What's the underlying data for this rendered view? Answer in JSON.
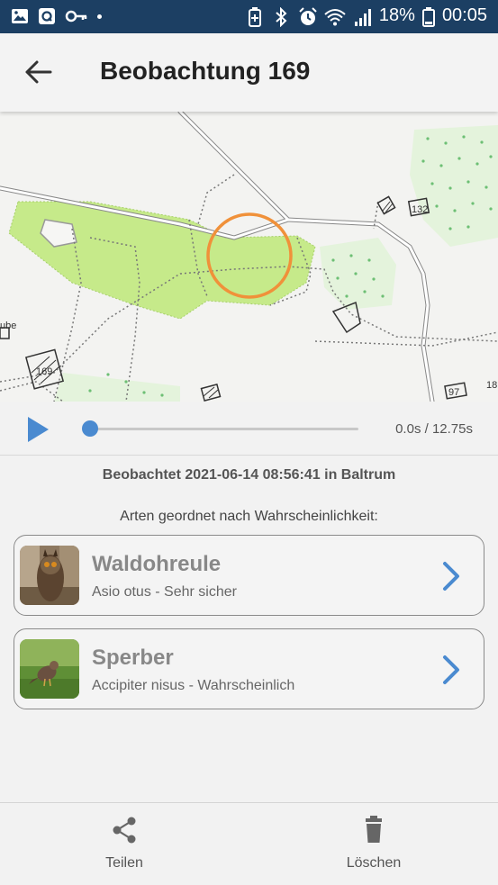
{
  "status_bar": {
    "battery": "18%",
    "time": "00:05"
  },
  "header": {
    "title": "Beobachtung 169"
  },
  "map": {
    "labels": [
      "132",
      "169",
      "97",
      "18",
      "ube"
    ]
  },
  "player": {
    "time": "0.0s / 12.75s",
    "progress": 0.0
  },
  "observation": {
    "observed_text": "Beobachtet 2021-06-14 08:56:41 in Baltrum",
    "species_heading": "Arten geordnet nach Wahrscheinlichkeit:"
  },
  "species": [
    {
      "name": "Waldohreule",
      "subtitle": "Asio otus - Sehr sicher"
    },
    {
      "name": "Sperber",
      "subtitle": "Accipiter nisus - Wahrscheinlich"
    }
  ],
  "bottom_bar": {
    "share_label": "Teilen",
    "delete_label": "Löschen"
  },
  "colors": {
    "status_bar": "#1c3f63",
    "accent_blue": "#4a8ad0",
    "map_green": "#c6ea8a",
    "marker_orange": "#f0913a"
  }
}
